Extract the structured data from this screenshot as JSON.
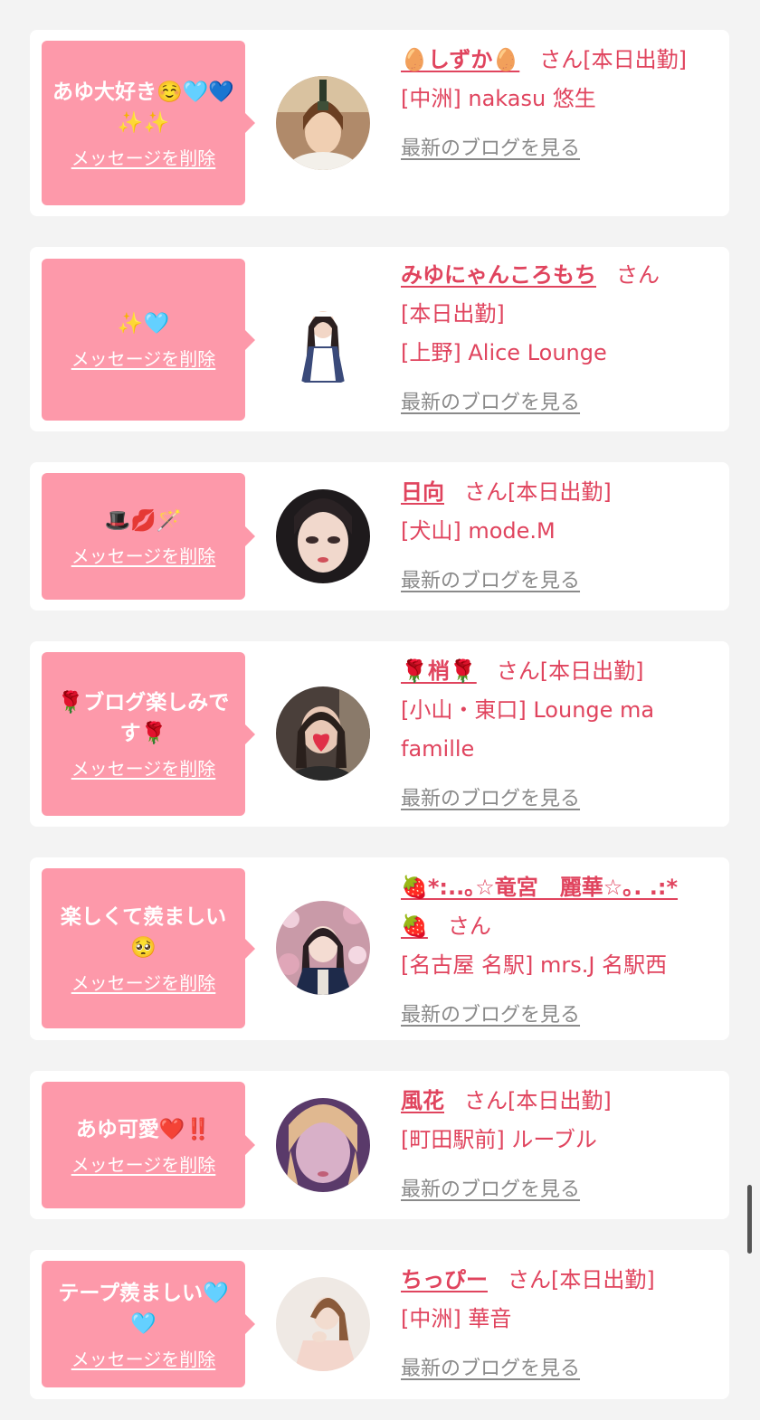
{
  "colors": {
    "page_bg": "#f3f3f3",
    "bubble_bg": "#fd99aa",
    "accent_text": "#e0445e",
    "link_gray": "#8a8a8a"
  },
  "cards": [
    {
      "message": "あゆ大好き☺️🩵💙✨✨",
      "delete_label": "メッセージを削除",
      "name": "🥚しずか🥚",
      "san": "さん",
      "status": "[本日出勤]",
      "shop": "[中洲] nakasu 悠生",
      "blog_label": "最新のブログを見る"
    },
    {
      "message": "✨🩵",
      "delete_label": "メッセージを削除",
      "name": "みゆにゃんころもち",
      "san": "さん",
      "status": "[本日出勤]",
      "shop": "[上野] Alice Lounge",
      "blog_label": "最新のブログを見る"
    },
    {
      "message": "🎩💋🪄",
      "delete_label": "メッセージを削除",
      "name": "日向",
      "san": "さん",
      "status": "[本日出勤]",
      "shop": "[犬山] mode.M",
      "blog_label": "最新のブログを見る"
    },
    {
      "message": "🌹ブログ楽しみです🌹",
      "delete_label": "メッセージを削除",
      "name": "🌹梢🌹",
      "san": "さん",
      "status": "[本日出勤]",
      "shop": "[小山・東口] Lounge ma famille",
      "blog_label": "最新のブログを見る"
    },
    {
      "message": "楽しくて羨ましい🥺",
      "delete_label": "メッセージを削除",
      "name": "🍓*:..｡☆竜宮　麗華☆｡. .:*🍓",
      "san": "さん",
      "status": "",
      "shop": "[名古屋 名駅] mrs.J 名駅西",
      "blog_label": "最新のブログを見る"
    },
    {
      "message": "あゆ可愛❤️‼️",
      "delete_label": "メッセージを削除",
      "name": "風花",
      "san": "さん",
      "status": "[本日出勤]",
      "shop": "[町田駅前] ルーブル",
      "blog_label": "最新のブログを見る"
    },
    {
      "message": "テープ羨ましい🩵🩵",
      "delete_label": "メッセージを削除",
      "name": "ちっぴー",
      "san": "さん",
      "status": "[本日出勤]",
      "shop": "[中洲] 華音",
      "blog_label": "最新のブログを見る"
    }
  ]
}
